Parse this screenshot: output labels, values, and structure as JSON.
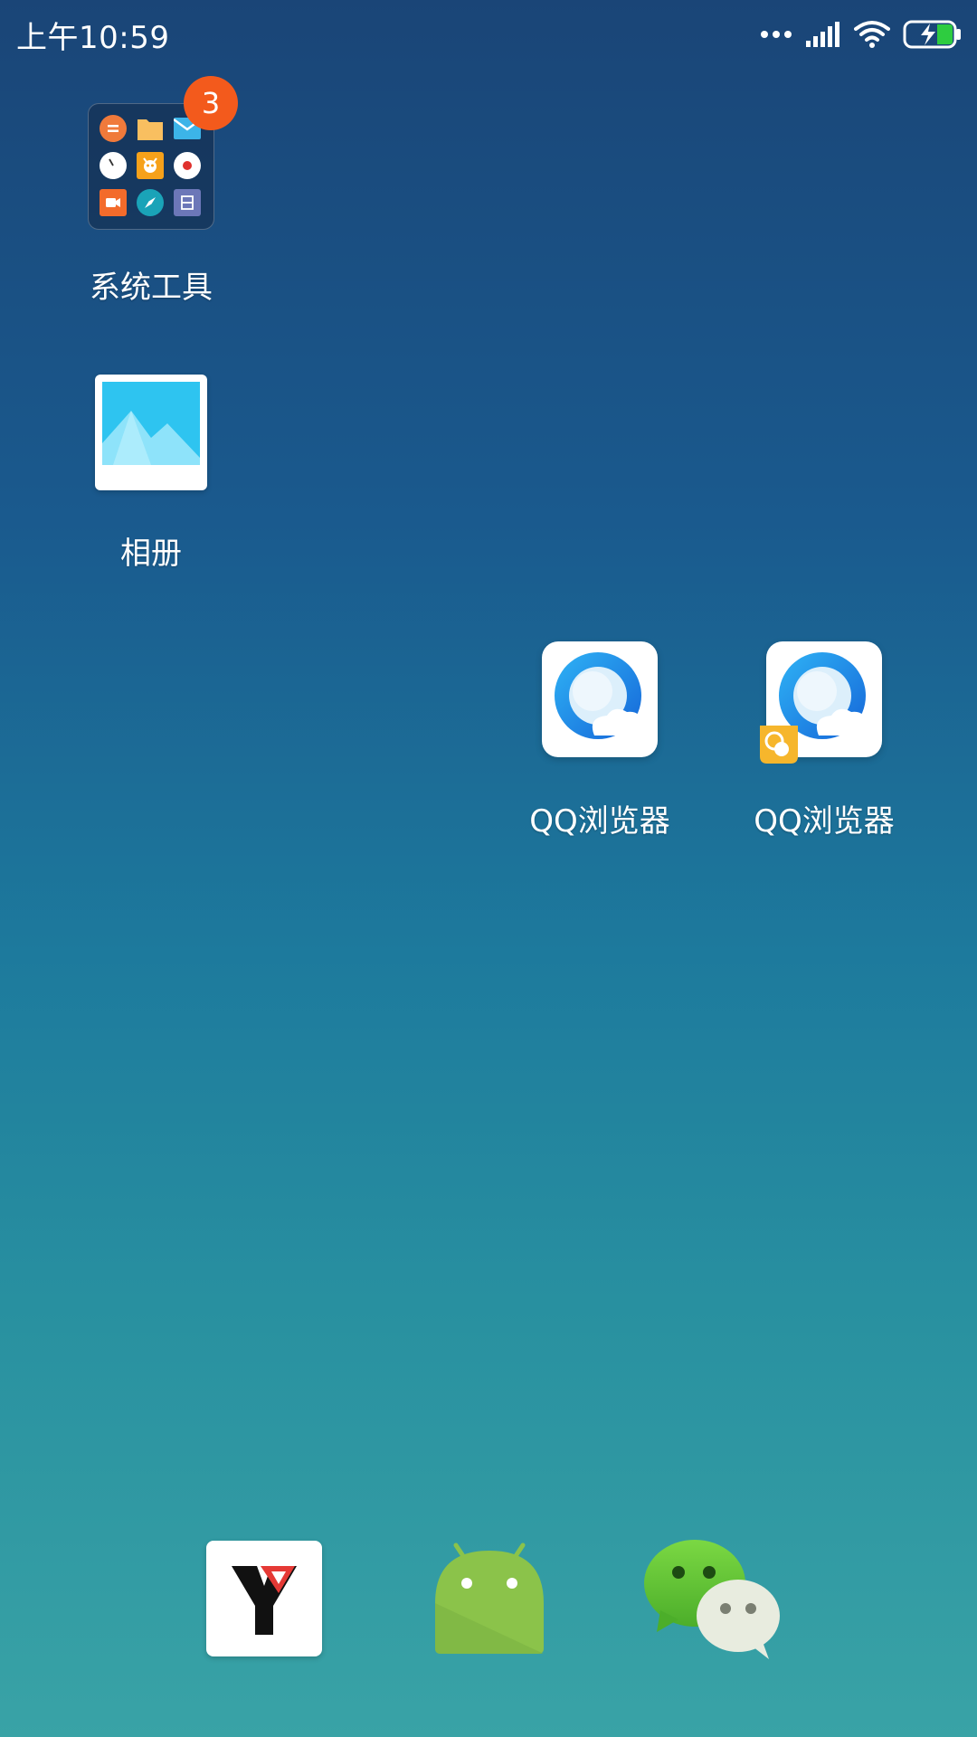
{
  "status_bar": {
    "time": "上午10:59",
    "icons": [
      "more-dots-icon",
      "signal-icon",
      "wifi-icon",
      "battery-charging-icon"
    ]
  },
  "home": {
    "folder": {
      "label": "系统工具",
      "badge_count": "3",
      "badge_color": "#f35a1c"
    },
    "gallery": {
      "label": "相册"
    },
    "qq_browser_1": {
      "label": "QQ浏览器"
    },
    "qq_browser_2": {
      "label": "QQ浏览器",
      "extra_badge": "clone-badge-icon"
    }
  },
  "dock": {
    "apps": [
      "y-app-icon",
      "android-app-icon",
      "wechat-icon"
    ]
  },
  "colors": {
    "wallpaper_top": "#1a4577",
    "wallpaper_bottom": "#39a3a6",
    "qq_blue": "#1e88e5",
    "wechat_green": "#62c33a",
    "android_green": "#8bc34a"
  }
}
